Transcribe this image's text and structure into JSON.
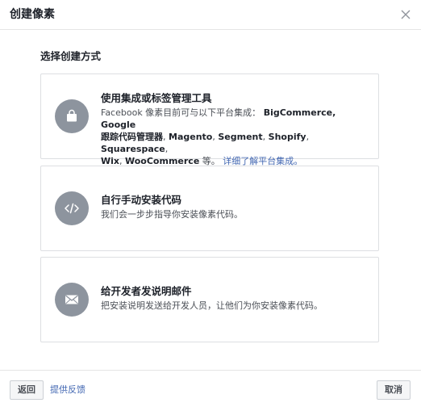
{
  "dialog": {
    "title": "创建像素",
    "close_icon": "close-icon"
  },
  "section": {
    "title": "选择创建方式"
  },
  "options": [
    {
      "icon": "shopping-bag-icon",
      "title": "使用集成或标签管理工具",
      "desc_prefix": "Facebook 像素目前可与以下平台集成：",
      "platforms_line1": "BigCommerce, Google",
      "platforms_line2_a": "跟踪代码管理器",
      "platforms_line2_b": "Magento",
      "platforms_line2_c": "Segment",
      "platforms_line2_d": "Shopify",
      "platforms_line2_e": "Squarespace",
      "platforms_line3_a": "Wix",
      "platforms_line3_b": "WooCommerce",
      "desc_suffix": "等。",
      "link": "详细了解平台集成。"
    },
    {
      "icon": "code-icon",
      "title": "自行手动安装代码",
      "desc": "我们会一步步指导你安装像素代码。"
    },
    {
      "icon": "envelope-icon",
      "title": "给开发者发说明邮件",
      "desc": "把安装说明发送给开发人员，让他们为你安装像素代码。"
    }
  ],
  "footer": {
    "back_label": "返回",
    "feedback_label": "提供反馈",
    "cancel_label": "取消"
  },
  "colors": {
    "icon_circle": "#8d949e",
    "link": "#4267b2",
    "border": "#dddfe2"
  }
}
